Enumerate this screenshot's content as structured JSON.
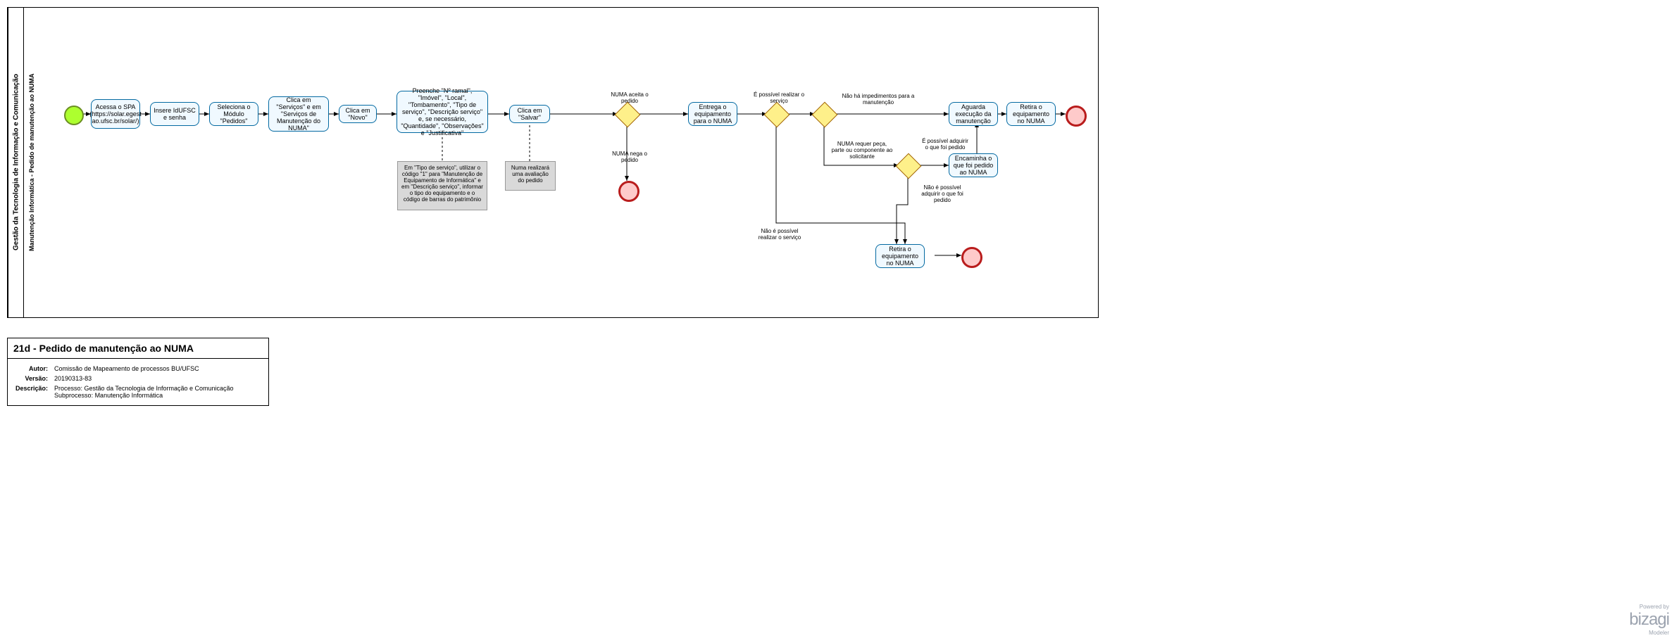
{
  "pool": "Gestão da Tecnologia de Informação e Comunicação",
  "lane": "Manutenção Informática - Pedido de manutenção ao NUMA",
  "tasks": {
    "t1": "Acessa o SPA (https://solar.egest ao.ufsc.br/solar/)",
    "t2": "Insere IdUFSC e senha",
    "t3": "Seleciona o Módulo \"Pedidos\"",
    "t4": "Clica em \"Serviços\" e em \"Serviços de Manutenção do NUMA\"",
    "t5": "Clica em \"Novo\"",
    "t6": "Preenche \"Nº ramal\", \"Imóvel\", \"Local\", \"Tombamento\", \"Tipo de serviço\", \"Descrição serviço\" e, se necessário, \"Quantidade\", \"Observações\" e \"Justificativa\"",
    "t7": "Clica em \"Salvar\"",
    "t8": "Entrega o equipamento para o NUMA",
    "t9": "Aguarda execução da manutenção",
    "t10": "Retira o equipamento no NUMA",
    "t11": "Encaminha o que foi pedido ao NUMA",
    "t12": "Retira o equipamento no NUMA"
  },
  "annotations": {
    "a1": "Em \"Tipo de serviço\", utilizar o código \"1\" para \"Manutenção de Equipamento de Informática\" e em \"Descrição serviço\", informar o tipo do equipamento e o código de barras do patrimônio",
    "a2": "Numa realizará uma avaliação do pedido"
  },
  "gw_labels": {
    "g1a": "NUMA aceita o pedido",
    "g1b": "NUMA nega o pedido",
    "g2a": "É possível realizar o serviço",
    "g2b": "Não é possível realizar o serviço",
    "g3a": "Não há impedimentos para a manutenção",
    "g3b": "NUMA requer peça, parte ou componente ao solicitante",
    "g4a": "É possível adquirir o que foi pedido",
    "g4b": "Não é possível adquirir o que foi pedido"
  },
  "info": {
    "title": "21d - Pedido de manutenção ao NUMA",
    "autor_k": "Autor:",
    "autor_v": "Comissão de Mapeamento de processos BU/UFSC",
    "versao_k": "Versão:",
    "versao_v": "20190313-83",
    "desc_k": "Descrição:",
    "desc_v1": "Processo: Gestão da Tecnologia de Informação e Comunicação",
    "desc_v2": "Subprocesso: Manutenção Informática"
  },
  "logo": {
    "powered": "Powered by",
    "brand": "bizagi",
    "sub": "Modeler"
  }
}
